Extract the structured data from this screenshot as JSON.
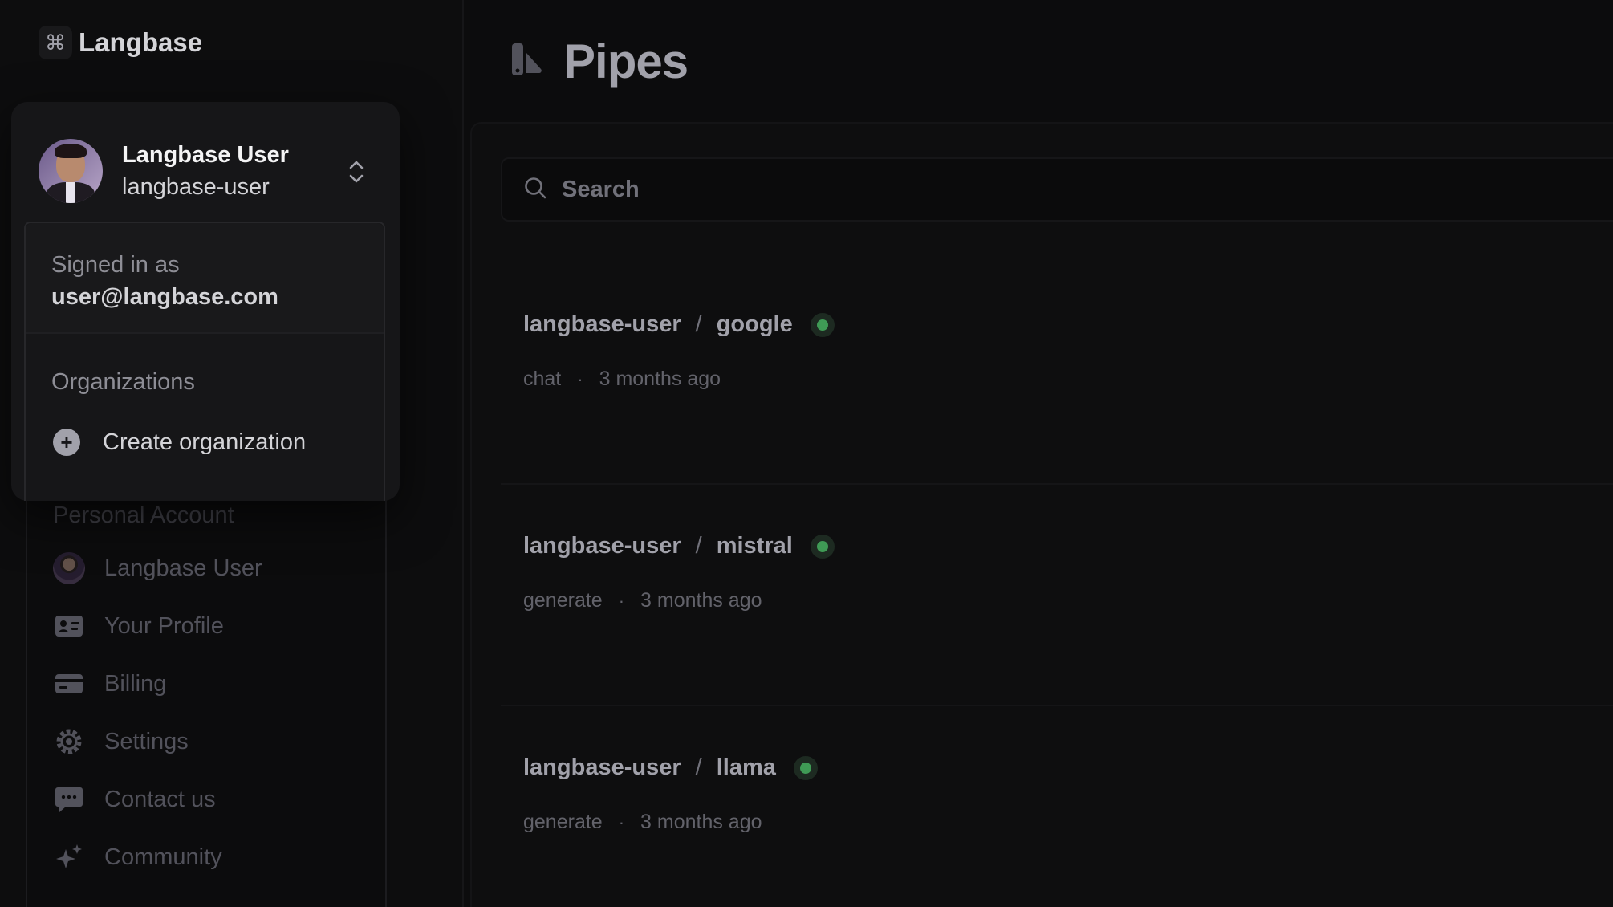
{
  "app": {
    "name": "Langbase"
  },
  "account": {
    "name": "Langbase User",
    "handle": "langbase-user",
    "signed_in_label": "Signed in as",
    "email": "user@langbase.com",
    "organizations_label": "Organizations",
    "create_org_label": "Create organization"
  },
  "sidebar": {
    "section_label": "Personal Account",
    "items": [
      {
        "label": "Langbase User",
        "icon": "avatar"
      },
      {
        "label": "Your Profile",
        "icon": "id-card-icon"
      },
      {
        "label": "Billing",
        "icon": "credit-card-icon"
      },
      {
        "label": "Settings",
        "icon": "gear-icon"
      },
      {
        "label": "Contact us",
        "icon": "chat-bubble-icon"
      },
      {
        "label": "Community",
        "icon": "sparkles-icon"
      }
    ]
  },
  "main": {
    "title": "Pipes",
    "search_placeholder": "Search",
    "pipes": [
      {
        "owner": "langbase-user",
        "separator": "/",
        "name": "google",
        "type": "chat",
        "meta_sep": "·",
        "updated": "3 months ago"
      },
      {
        "owner": "langbase-user",
        "separator": "/",
        "name": "mistral",
        "type": "generate",
        "meta_sep": "·",
        "updated": "3 months ago"
      },
      {
        "owner": "langbase-user",
        "separator": "/",
        "name": "llama",
        "type": "generate",
        "meta_sep": "·",
        "updated": "3 months ago"
      }
    ]
  },
  "colors": {
    "background": "#0c0c0d",
    "status_active": "#3f9a55",
    "popover": "#161618"
  }
}
